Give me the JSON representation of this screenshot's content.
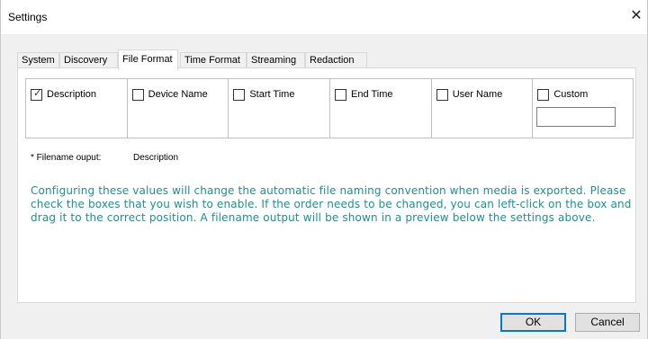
{
  "window": {
    "title": "Settings",
    "close_glyph": "✕"
  },
  "tabs": [
    {
      "label": "System",
      "active": false
    },
    {
      "label": "Discovery",
      "active": false
    },
    {
      "label": "File Format",
      "active": true
    },
    {
      "label": "Time Format",
      "active": false
    },
    {
      "label": "Streaming",
      "active": false
    },
    {
      "label": "Redaction",
      "active": false
    }
  ],
  "fields": [
    {
      "label": "Description",
      "checked": true
    },
    {
      "label": "Device Name",
      "checked": false
    },
    {
      "label": "Start Time",
      "checked": false
    },
    {
      "label": "End Time",
      "checked": false
    },
    {
      "label": "User Name",
      "checked": false
    },
    {
      "label": "Custom",
      "checked": false,
      "input_value": ""
    }
  ],
  "filename_output": {
    "label": "* Filename ouput:",
    "value": "Description"
  },
  "info_text": "Configuring these values will change the automatic file naming convention when media is exported. Please check the boxes that you wish to enable. If the order needs to be changed, you can left-click on the box and drag it to the correct position. A filename output will be shown in a preview below the settings above.",
  "buttons": {
    "ok": "OK",
    "cancel": "Cancel"
  },
  "colors": {
    "info_text": "#1f8f8f",
    "ok_focus": "#0078d7"
  }
}
